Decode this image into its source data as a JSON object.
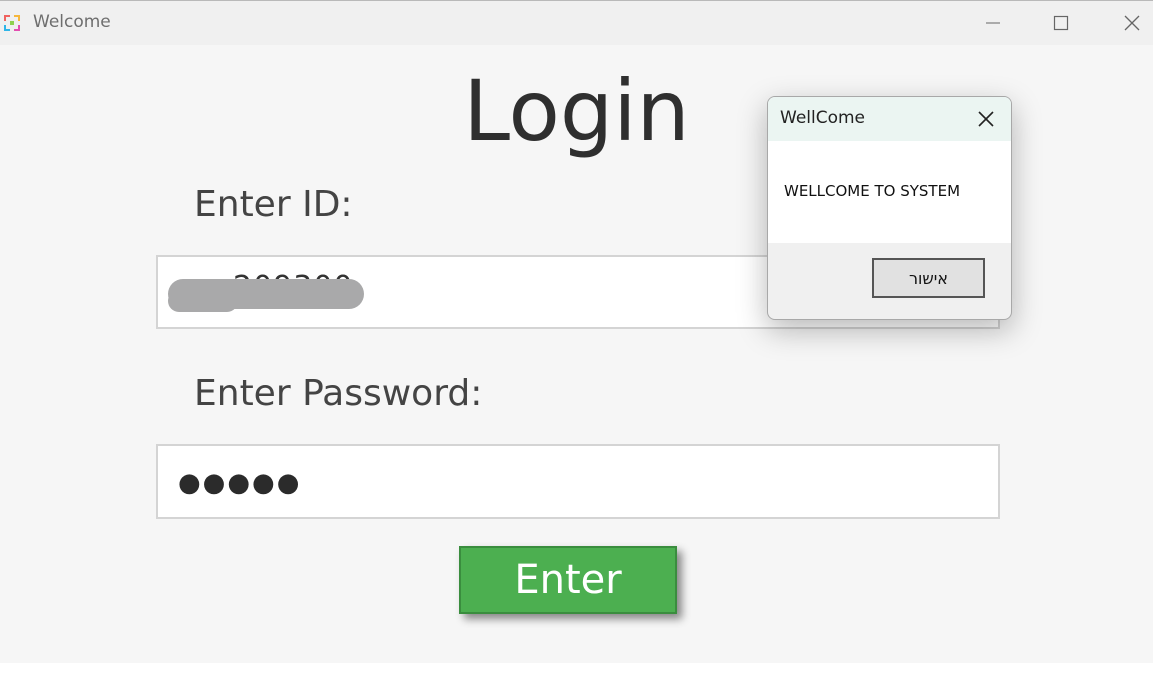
{
  "window": {
    "title": "Welcome",
    "controls": {
      "minimize_icon": "minimize-icon",
      "maximize_icon": "maximize-icon",
      "close_icon": "close-icon"
    }
  },
  "login": {
    "title": "Login",
    "id_label": "Enter ID:",
    "id_value_visible": "209300",
    "password_label": "Enter Password:",
    "password_value": "●●●●●",
    "enter_label": "Enter"
  },
  "dialog": {
    "title": "WellCome",
    "message": "WELLCOME TO SYSTEM",
    "ok_label": "אישור"
  },
  "colors": {
    "enter_button": "#4caf50",
    "dialog_titlebar": "#ebf5f2",
    "window_background": "#f6f6f6"
  }
}
